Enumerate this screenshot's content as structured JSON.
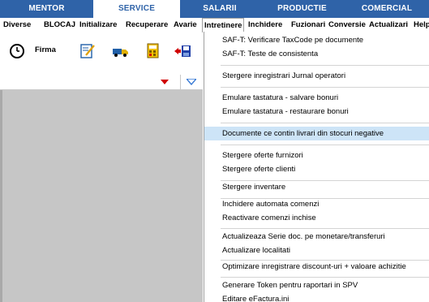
{
  "tabs": [
    "MENTOR",
    "SERVICE",
    "SALARII",
    "PRODUCTIE",
    "COMERCIAL"
  ],
  "active_tab": "SERVICE",
  "menubar": [
    "Diverse",
    "BLOCAJ",
    "Initializare",
    "Recuperare",
    "Avarie",
    "Intretinere",
    "Inchidere",
    "Fuzionari",
    "Conversie",
    "Actualizari",
    "Help"
  ],
  "toolbar": {
    "firma_label": "Firma",
    "icons": [
      "clock-icon",
      "edit-document-icon",
      "truck-icon",
      "calculator-icon",
      "save-export-icon"
    ]
  },
  "dropdown": {
    "items": [
      "SAF-T: Verificare TaxCode pe documente",
      "SAF-T: Teste de consistenta",
      "Stergere inregistrari Jurnal operatori",
      "Emulare tastatura - salvare bonuri",
      "Emulare tastatura - restaurare bonuri",
      "Documente ce contin livrari din stocuri negative",
      "Stergere oferte furnizori",
      "Stergere oferte clienti",
      "Stergere inventare",
      "Inchidere automata comenzi",
      "Reactivare comenzi inchise",
      "Actualizeaza Serie doc. pe monetare/transferuri",
      "Actualizare localitati",
      "Optimizare inregistrare discount-uri + valoare achizitie",
      "Generare Token pentru raportari in SPV",
      "Editare eFactura.ini"
    ],
    "highlighted_index": 5
  },
  "colors": {
    "tab_bar": "#2f63a8",
    "highlight": "#cde4f7",
    "left_pane": "#c6c6c6"
  }
}
